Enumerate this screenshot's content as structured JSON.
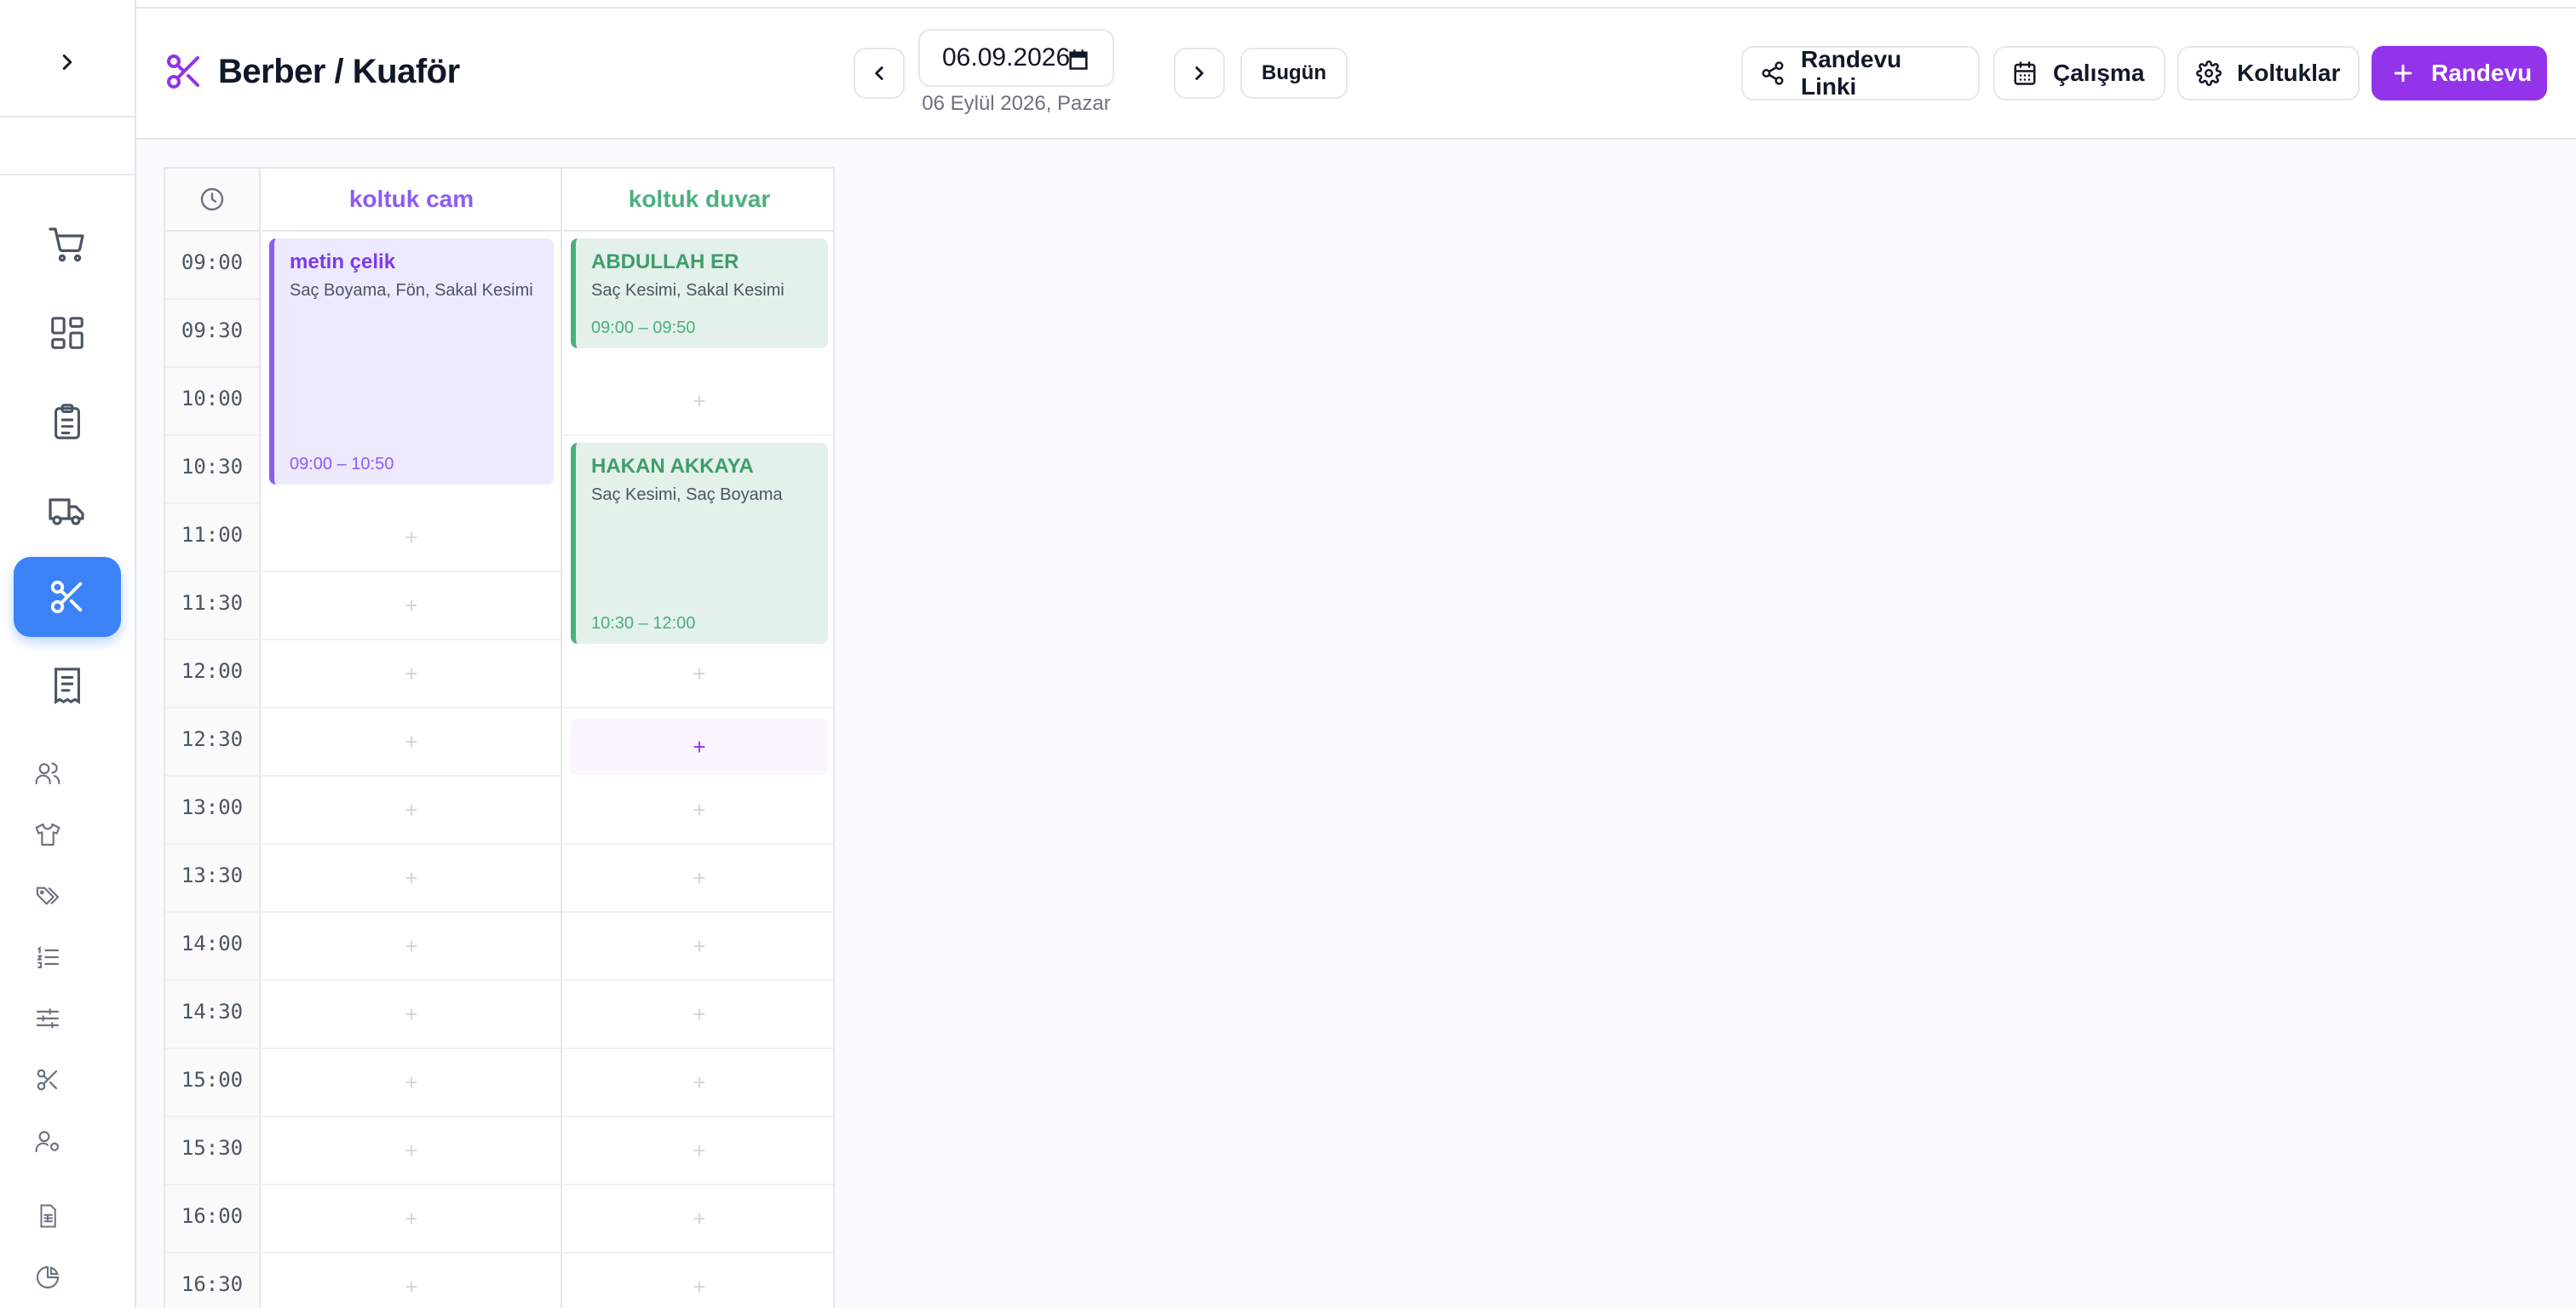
{
  "header": {
    "title": "Berber / Kuaför",
    "date_value": "06.09.2026",
    "date_display": "06 Eylül 2026, Pazar",
    "today_label": "Bugün",
    "buttons": {
      "link_label": "Randevu Linki",
      "work_label": "Çalışma",
      "chairs_label": "Koltuklar",
      "new_label": "Randevu"
    }
  },
  "sidebar": {
    "items": [
      {
        "icon": "cart-icon"
      },
      {
        "icon": "dashboard-icon"
      },
      {
        "icon": "clipboard-icon"
      },
      {
        "icon": "truck-icon"
      },
      {
        "icon": "scissors-icon",
        "active": true
      },
      {
        "icon": "receipt-icon"
      },
      {
        "icon": "users-icon"
      },
      {
        "icon": "shirt-icon"
      },
      {
        "icon": "tags-icon"
      },
      {
        "icon": "list-icon"
      },
      {
        "icon": "sliders-icon"
      },
      {
        "icon": "scissors-small-icon"
      },
      {
        "icon": "user-settings-icon"
      },
      {
        "icon": "spreadsheet-icon"
      },
      {
        "icon": "pie-chart-icon"
      }
    ]
  },
  "schedule": {
    "times": [
      "09:00",
      "09:30",
      "10:00",
      "10:30",
      "11:00",
      "11:30",
      "12:00",
      "12:30",
      "13:00",
      "13:30",
      "14:00",
      "14:30",
      "15:00",
      "15:30",
      "16:00",
      "16:30"
    ],
    "columns": [
      {
        "name": "koltuk cam",
        "color": "#8b5cf6"
      },
      {
        "name": "koltuk duvar",
        "color": "#4caf7d"
      }
    ],
    "slot_symbol": "+",
    "appointments": [
      {
        "column": 0,
        "name": "metin çelik",
        "services": "Saç Boyama, Fön, Sakal Kesimi",
        "time": "09:00 – 10:50",
        "start": "09:00",
        "end": "10:50"
      },
      {
        "column": 1,
        "name": "ABDULLAH ER",
        "services": "Saç Kesimi, Sakal Kesimi",
        "time": "09:00 – 09:50",
        "start": "09:00",
        "end": "09:50"
      },
      {
        "column": 1,
        "name": "HAKAN AKKAYA",
        "services": "Saç Kesimi, Saç Boyama",
        "time": "10:30 – 12:00",
        "start": "10:30",
        "end": "12:00"
      }
    ],
    "highlight_slot": {
      "column": 1,
      "time": "12:30"
    }
  },
  "colors": {
    "accent": "#9333ea",
    "active_nav": "#3b82f6"
  }
}
